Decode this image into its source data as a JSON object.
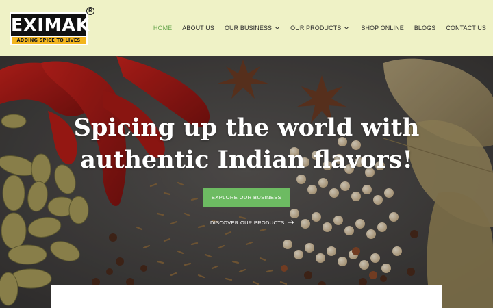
{
  "brand": {
    "name": "EXIMAK",
    "tagline": "ADDING SPICE TO LIVES",
    "registered_mark": "R"
  },
  "nav": {
    "items": [
      {
        "label": "HOME",
        "active": true,
        "dropdown": false
      },
      {
        "label": "ABOUT US",
        "active": false,
        "dropdown": false
      },
      {
        "label": "OUR BUSINESS",
        "active": false,
        "dropdown": true
      },
      {
        "label": "OUR PRODUCTS",
        "active": false,
        "dropdown": true
      },
      {
        "label": "SHOP ONLINE",
        "active": false,
        "dropdown": false
      },
      {
        "label": "BLOGS",
        "active": false,
        "dropdown": false
      },
      {
        "label": "CONTACT US",
        "active": false,
        "dropdown": false
      }
    ]
  },
  "hero": {
    "title_line1": "Spicing up the world with",
    "title_line2": "authentic Indian flavors!",
    "primary_button": "EXPLORE OUR BUSINESS",
    "secondary_link": "DISCOVER OUR PRODUCTS"
  },
  "colors": {
    "header_bg": "#eff2c6",
    "accent_green": "#6dbb62",
    "nav_active": "#6aa84f",
    "logo_yellow": "#f2b51e"
  },
  "icons": {
    "dropdown": "chevron-down-icon",
    "link_arrow": "arrow-right-icon"
  }
}
